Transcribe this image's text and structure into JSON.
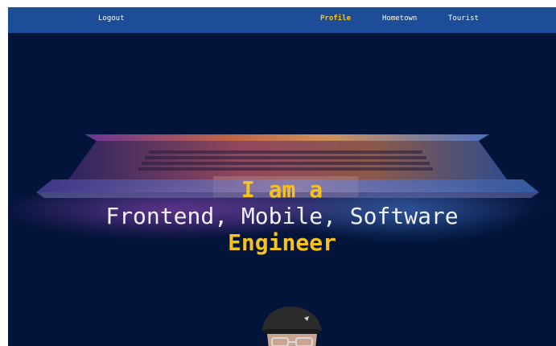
{
  "nav": {
    "logout": "Logout",
    "links": [
      {
        "label": "Profile",
        "active": true
      },
      {
        "label": "Hometown",
        "active": false
      },
      {
        "label": "Tourist",
        "active": false
      }
    ]
  },
  "hero": {
    "line1": "I am a",
    "line2": "Frontend, Mobile, Software",
    "line3": "Engineer"
  },
  "colors": {
    "background": "#03143a",
    "navbar": "#1c4d96",
    "accent": "#f7c21c",
    "text": "#eef1f7"
  },
  "icons": [
    "laptop-image",
    "profile-avatar"
  ]
}
